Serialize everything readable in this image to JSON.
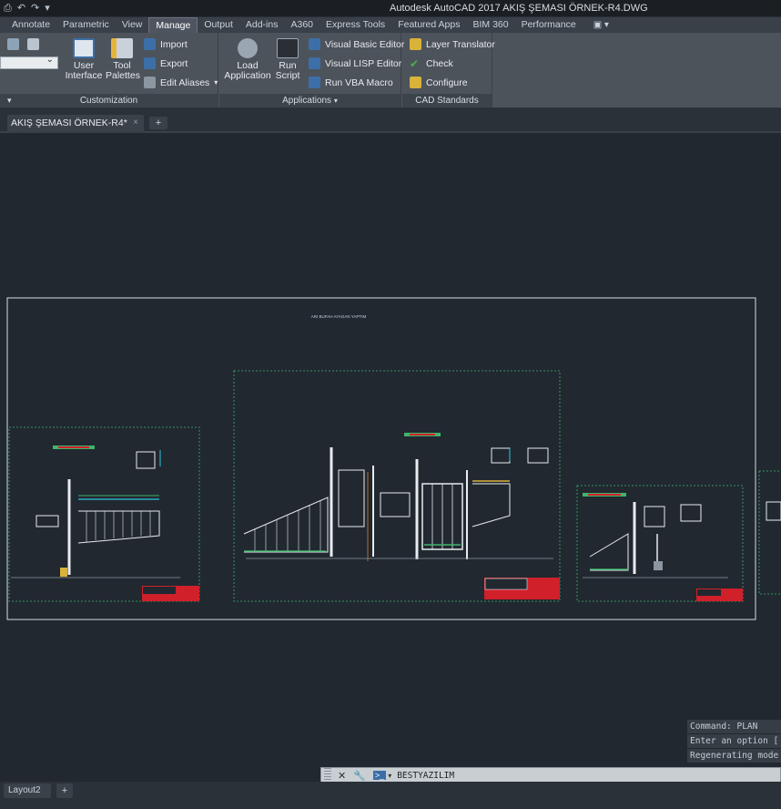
{
  "window": {
    "title": "Autodesk AutoCAD 2017    AKIŞ ŞEMASI ÖRNEK-R4.DWG"
  },
  "qat": {
    "icons": [
      "print-icon",
      "undo-icon",
      "redo-icon",
      "dropdown-icon"
    ]
  },
  "tabs": [
    {
      "label": "Annotate",
      "active": false
    },
    {
      "label": "Parametric",
      "active": false
    },
    {
      "label": "View",
      "active": false
    },
    {
      "label": "Manage",
      "active": true
    },
    {
      "label": "Output",
      "active": false
    },
    {
      "label": "Add-ins",
      "active": false
    },
    {
      "label": "A360",
      "active": false
    },
    {
      "label": "Express Tools",
      "active": false
    },
    {
      "label": "Featured Apps",
      "active": false
    },
    {
      "label": "BIM 360",
      "active": false
    },
    {
      "label": "Performance",
      "active": false
    }
  ],
  "ribbon": {
    "customization": {
      "title": "Customization",
      "user_interface": "User\nInterface",
      "tool_palettes": "Tool\nPalettes",
      "import": "Import",
      "export": "Export",
      "edit_aliases": "Edit Aliases"
    },
    "applications": {
      "title": "Applications",
      "load_application": "Load\nApplication",
      "run_script": "Run\nScript",
      "vbe": "Visual Basic Editor",
      "vlisp": "Visual LISP Editor",
      "vba_macro": "Run VBA Macro"
    },
    "cad_standards": {
      "title": "CAD Standards",
      "layer_translator": "Layer Translator",
      "check": "Check",
      "configure": "Configure"
    }
  },
  "file_tab": {
    "label": "AKIŞ ŞEMASI ÖRNEK-R4*",
    "close": "×",
    "new": "+"
  },
  "drawing": {
    "frame_title": "ARI BUFAH AYAGAN YAPTIM"
  },
  "command_history": [
    "Command: PLAN",
    "Enter an option [",
    "Regenerating mode"
  ],
  "command_line": {
    "prompt_icon": ">_",
    "text": "BESTYAZILIM"
  },
  "layouts": {
    "tab": "Layout2",
    "add": "+"
  },
  "colors": {
    "canvas": "#212830",
    "ribbon": "#4d535b",
    "accent_red": "#d0202a",
    "accent_cyan": "#2ec4d6",
    "accent_green": "#4caf50"
  }
}
